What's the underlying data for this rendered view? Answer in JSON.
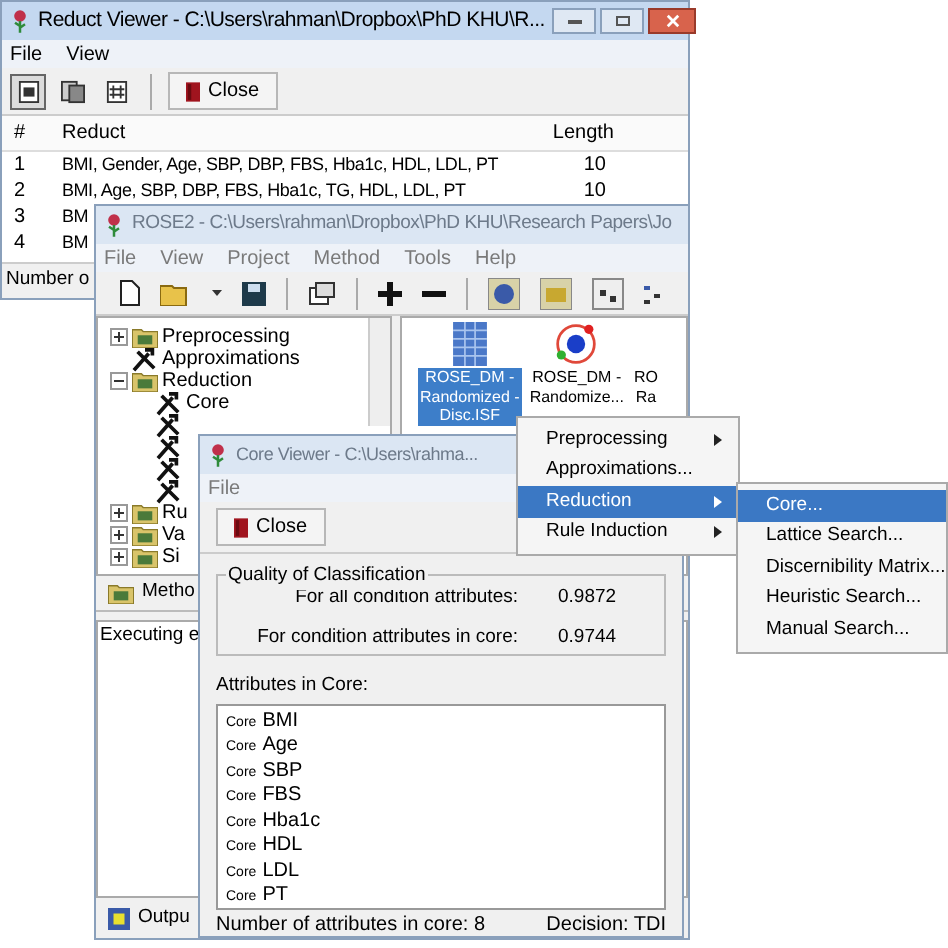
{
  "reduct_viewer": {
    "title": "Reduct Viewer - C:\\Users\\rahman\\Dropbox\\PhD KHU\\R...",
    "menu": [
      "File",
      "View"
    ],
    "toolbar": [
      {
        "pressed": true
      },
      {
        "pressed": false
      },
      {
        "pressed": false
      }
    ],
    "close_button": "Close",
    "table": {
      "columns": [
        "#",
        "Reduct",
        "Length"
      ],
      "rows": [
        {
          "cells": [
            "1",
            "BMI, Gender, Age, SBP, DBP, FBS, Hba1c, HDL, LDL, PT",
            "10"
          ]
        },
        {
          "cells": [
            "2",
            "BMI, Age, SBP, DBP, FBS, Hba1c, TG, HDL, LDL, PT",
            "10"
          ]
        },
        {
          "cells": [
            "3",
            "BM"
          ]
        },
        {
          "cells": [
            "4",
            "BM"
          ]
        }
      ]
    },
    "status_bar": "Number o"
  },
  "rose2": {
    "title": "ROSE2 - C:\\Users\\rahman\\Dropbox\\PhD KHU\\Research Papers\\Jo",
    "menu": [
      "File",
      "View",
      "Project",
      "Method",
      "Tools",
      "Help"
    ],
    "tree": [
      {
        "kind": "folder",
        "label": "Preprocessing",
        "expanded": false
      },
      {
        "kind": "method",
        "label": "Approximations"
      },
      {
        "kind": "folder",
        "label": "Reduction",
        "expanded": true,
        "children": [
          {
            "kind": "method",
            "label": "Core"
          },
          {
            "kind": "method"
          },
          {
            "kind": "method"
          },
          {
            "kind": "method"
          },
          {
            "kind": "method"
          }
        ]
      },
      {
        "kind": "folder",
        "label": "Ru",
        "expanded": false
      },
      {
        "kind": "folder",
        "label": "Va",
        "expanded": false
      },
      {
        "kind": "folder",
        "label": "Si",
        "expanded": false
      }
    ],
    "methods_tab": "Metho",
    "output_text": "Executing e",
    "output_tab": "Outpu",
    "files": [
      {
        "kind": "table",
        "lines": [
          "ROSE_DM -",
          "Randomized -",
          "Disc.ISF"
        ],
        "selected": true
      },
      {
        "kind": "model",
        "lines": [
          "ROSE_DM -",
          "Randomize..."
        ],
        "selected": false
      },
      {
        "kind": "partial",
        "lines": [
          "RO",
          "Ra"
        ],
        "selected": false
      }
    ]
  },
  "core_viewer": {
    "title": "Core Viewer - C:\\Users\\rahma...",
    "menu": [
      "File"
    ],
    "close_button": "Close",
    "quality": {
      "title": "Quality of Classification",
      "rows": [
        {
          "label": "For all condition attributes:",
          "value": "0.9872"
        },
        {
          "label": "For condition attributes in core:",
          "value": "0.9744"
        }
      ]
    },
    "attributes_label": "Attributes in Core:",
    "attributes": [
      {
        "tag": "Core",
        "name": "BMI"
      },
      {
        "tag": "Core",
        "name": "Age"
      },
      {
        "tag": "Core",
        "name": "SBP"
      },
      {
        "tag": "Core",
        "name": "FBS"
      },
      {
        "tag": "Core",
        "name": "Hba1c"
      },
      {
        "tag": "Core",
        "name": "HDL"
      },
      {
        "tag": "Core",
        "name": "LDL"
      },
      {
        "tag": "Core",
        "name": "PT"
      }
    ],
    "status": [
      "Number of attributes in core: 8",
      "Decision: TDI"
    ]
  },
  "context_menu": {
    "items": [
      {
        "label": "Preprocessing",
        "submenu": true,
        "selected": false
      },
      {
        "label": "Approximations...",
        "submenu": false,
        "selected": false
      },
      {
        "label": "Reduction",
        "submenu": true,
        "selected": true
      },
      {
        "label": "Rule Induction",
        "submenu": true,
        "selected": false
      }
    ]
  },
  "submenu": {
    "items": [
      {
        "label": "Core...",
        "selected": true
      },
      {
        "label": "Lattice Search...",
        "selected": false
      },
      {
        "label": "Discernibility Matrix...",
        "selected": false
      },
      {
        "label": "Heuristic Search...",
        "selected": false
      },
      {
        "label": "Manual Search...",
        "selected": false
      }
    ]
  }
}
